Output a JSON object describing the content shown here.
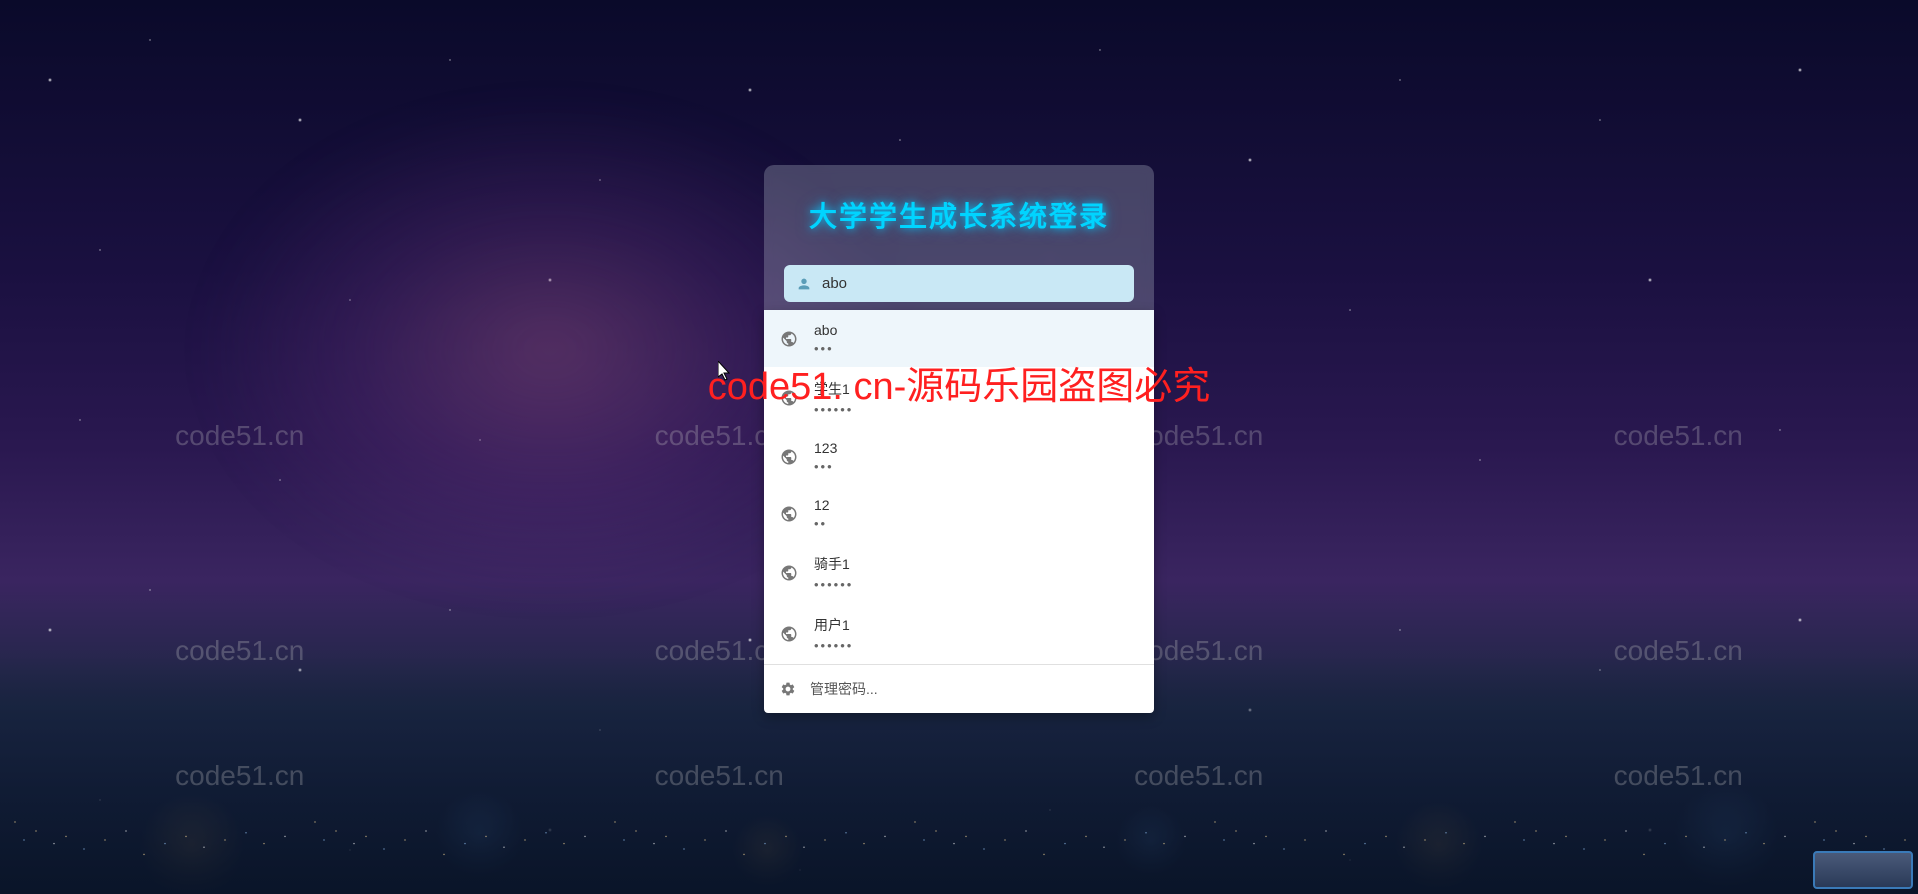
{
  "login": {
    "title": "大学学生成长系统登录",
    "username_value": "abo"
  },
  "autocomplete": {
    "items": [
      {
        "username": "abo",
        "password_mask": "•••",
        "highlighted": true
      },
      {
        "username": "学生1",
        "password_mask": "••••••",
        "highlighted": false
      },
      {
        "username": "123",
        "password_mask": "•••",
        "highlighted": false
      },
      {
        "username": "12",
        "password_mask": "••",
        "highlighted": false
      },
      {
        "username": "骑手1",
        "password_mask": "••••••",
        "highlighted": false
      },
      {
        "username": "用户1",
        "password_mask": "••••••",
        "highlighted": false
      }
    ],
    "footer_label": "管理密码..."
  },
  "watermark": {
    "small": "code51.cn",
    "main": "code51. cn-源码乐园盗图必究"
  }
}
